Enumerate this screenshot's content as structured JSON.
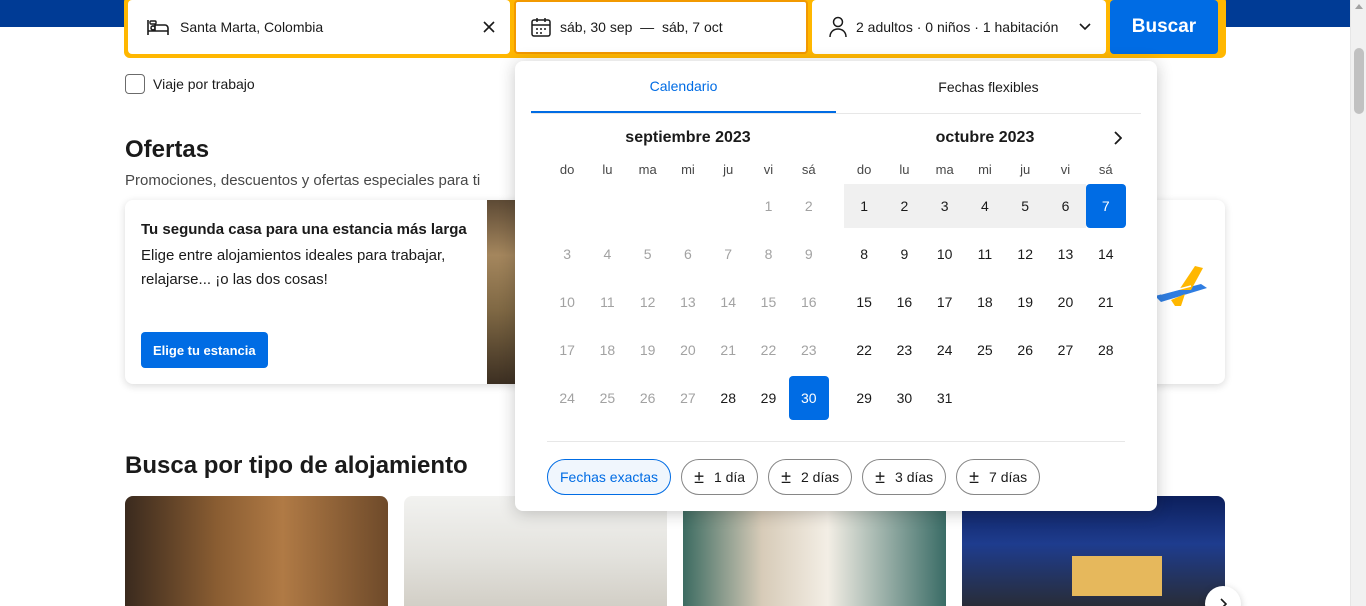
{
  "search": {
    "destination": "Santa Marta, Colombia",
    "dates": "sáb, 30 sep  —  sáb, 7 oct",
    "guests": "2 adultos · 0 niños · 1 habitación",
    "search_button": "Buscar",
    "business_trip_label": "Viaje por trabajo"
  },
  "ofertas": {
    "title": "Ofertas",
    "subtitle": "Promociones, descuentos y ofertas especiales para ti",
    "card": {
      "title": "Tu segunda casa para una estancia más larga",
      "description": "Elige entre alojamientos ideales para trabajar, relajarse... ¡o las dos cosas!",
      "button": "Elige tu estancia"
    }
  },
  "property_types": {
    "title": "Busca por tipo de alojamiento"
  },
  "calendar": {
    "tabs": [
      "Calendario",
      "Fechas flexibles"
    ],
    "active_tab": 0,
    "weekdays": [
      "do",
      "lu",
      "ma",
      "mi",
      "ju",
      "vi",
      "sá"
    ],
    "months": [
      {
        "title": "septiembre 2023",
        "days": [
          {
            "d": "",
            "s": "empty"
          },
          {
            "d": "",
            "s": "empty"
          },
          {
            "d": "",
            "s": "empty"
          },
          {
            "d": "",
            "s": "empty"
          },
          {
            "d": "",
            "s": "empty"
          },
          {
            "d": "1",
            "s": "past"
          },
          {
            "d": "2",
            "s": "past"
          },
          {
            "d": "3",
            "s": "past"
          },
          {
            "d": "4",
            "s": "past"
          },
          {
            "d": "5",
            "s": "past"
          },
          {
            "d": "6",
            "s": "past"
          },
          {
            "d": "7",
            "s": "past"
          },
          {
            "d": "8",
            "s": "past"
          },
          {
            "d": "9",
            "s": "past"
          },
          {
            "d": "10",
            "s": "past"
          },
          {
            "d": "11",
            "s": "past"
          },
          {
            "d": "12",
            "s": "past"
          },
          {
            "d": "13",
            "s": "past"
          },
          {
            "d": "14",
            "s": "past"
          },
          {
            "d": "15",
            "s": "past"
          },
          {
            "d": "16",
            "s": "past"
          },
          {
            "d": "17",
            "s": "past"
          },
          {
            "d": "18",
            "s": "past"
          },
          {
            "d": "19",
            "s": "past"
          },
          {
            "d": "20",
            "s": "past"
          },
          {
            "d": "21",
            "s": "past"
          },
          {
            "d": "22",
            "s": "past"
          },
          {
            "d": "23",
            "s": "past"
          },
          {
            "d": "24",
            "s": "past"
          },
          {
            "d": "25",
            "s": "past"
          },
          {
            "d": "26",
            "s": "past"
          },
          {
            "d": "27",
            "s": "past"
          },
          {
            "d": "28",
            "s": "normal"
          },
          {
            "d": "29",
            "s": "normal"
          },
          {
            "d": "30",
            "s": "selected"
          }
        ]
      },
      {
        "title": "octubre 2023",
        "days": [
          {
            "d": "1",
            "s": "inrange"
          },
          {
            "d": "2",
            "s": "inrange"
          },
          {
            "d": "3",
            "s": "inrange"
          },
          {
            "d": "4",
            "s": "inrange"
          },
          {
            "d": "5",
            "s": "inrange"
          },
          {
            "d": "6",
            "s": "inrange"
          },
          {
            "d": "7",
            "s": "selected"
          },
          {
            "d": "8",
            "s": "normal"
          },
          {
            "d": "9",
            "s": "normal"
          },
          {
            "d": "10",
            "s": "normal"
          },
          {
            "d": "11",
            "s": "normal"
          },
          {
            "d": "12",
            "s": "normal"
          },
          {
            "d": "13",
            "s": "normal"
          },
          {
            "d": "14",
            "s": "normal"
          },
          {
            "d": "15",
            "s": "normal"
          },
          {
            "d": "16",
            "s": "normal"
          },
          {
            "d": "17",
            "s": "normal"
          },
          {
            "d": "18",
            "s": "normal"
          },
          {
            "d": "19",
            "s": "normal"
          },
          {
            "d": "20",
            "s": "normal"
          },
          {
            "d": "21",
            "s": "normal"
          },
          {
            "d": "22",
            "s": "normal"
          },
          {
            "d": "23",
            "s": "normal"
          },
          {
            "d": "24",
            "s": "normal"
          },
          {
            "d": "25",
            "s": "normal"
          },
          {
            "d": "26",
            "s": "normal"
          },
          {
            "d": "27",
            "s": "normal"
          },
          {
            "d": "28",
            "s": "normal"
          },
          {
            "d": "29",
            "s": "normal"
          },
          {
            "d": "30",
            "s": "normal"
          },
          {
            "d": "31",
            "s": "normal"
          }
        ]
      }
    ],
    "chips": [
      {
        "label": "Fechas exactas",
        "active": true,
        "plusminus": false
      },
      {
        "label": "1 día",
        "active": false,
        "plusminus": true
      },
      {
        "label": "2 días",
        "active": false,
        "plusminus": true
      },
      {
        "label": "3 días",
        "active": false,
        "plusminus": true
      },
      {
        "label": "7 días",
        "active": false,
        "plusminus": true
      }
    ]
  },
  "colors": {
    "brand_blue": "#003b95",
    "action_blue": "#006ce4",
    "search_border": "#ffb700"
  },
  "icons": {
    "destination": "bed-icon",
    "clear": "close-icon",
    "dates": "calendar-icon",
    "guests": "person-icon",
    "guests_dropdown": "chevron-down-icon",
    "calendar_next": "chevron-right-icon",
    "carousel_next": "chevron-right-icon"
  }
}
